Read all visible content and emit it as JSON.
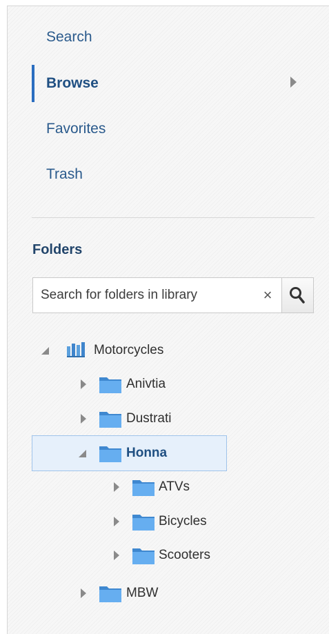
{
  "nav": {
    "items": [
      {
        "label": "Search",
        "active": false
      },
      {
        "label": "Browse",
        "active": true
      },
      {
        "label": "Favorites",
        "active": false
      },
      {
        "label": "Trash",
        "active": false
      }
    ]
  },
  "folders": {
    "title": "Folders",
    "search": {
      "placeholder": "Search for folders in library",
      "value": ""
    },
    "tree": {
      "library": {
        "label": "Motorcycles",
        "icon": "library-icon",
        "expanded": true
      },
      "items": [
        {
          "label": "Anivtia",
          "expanded": false,
          "selected": false
        },
        {
          "label": "Dustrati",
          "expanded": false,
          "selected": false
        },
        {
          "label": "Honna",
          "expanded": true,
          "selected": true,
          "children": [
            {
              "label": "ATVs",
              "expanded": false
            },
            {
              "label": "Bicycles",
              "expanded": false
            },
            {
              "label": "Scooters",
              "expanded": false
            }
          ]
        },
        {
          "label": "MBW",
          "expanded": false,
          "selected": false
        }
      ]
    }
  },
  "colors": {
    "accent": "#2b6ec0",
    "folder": "#5ba0dd",
    "link": "#2a5a8c"
  }
}
